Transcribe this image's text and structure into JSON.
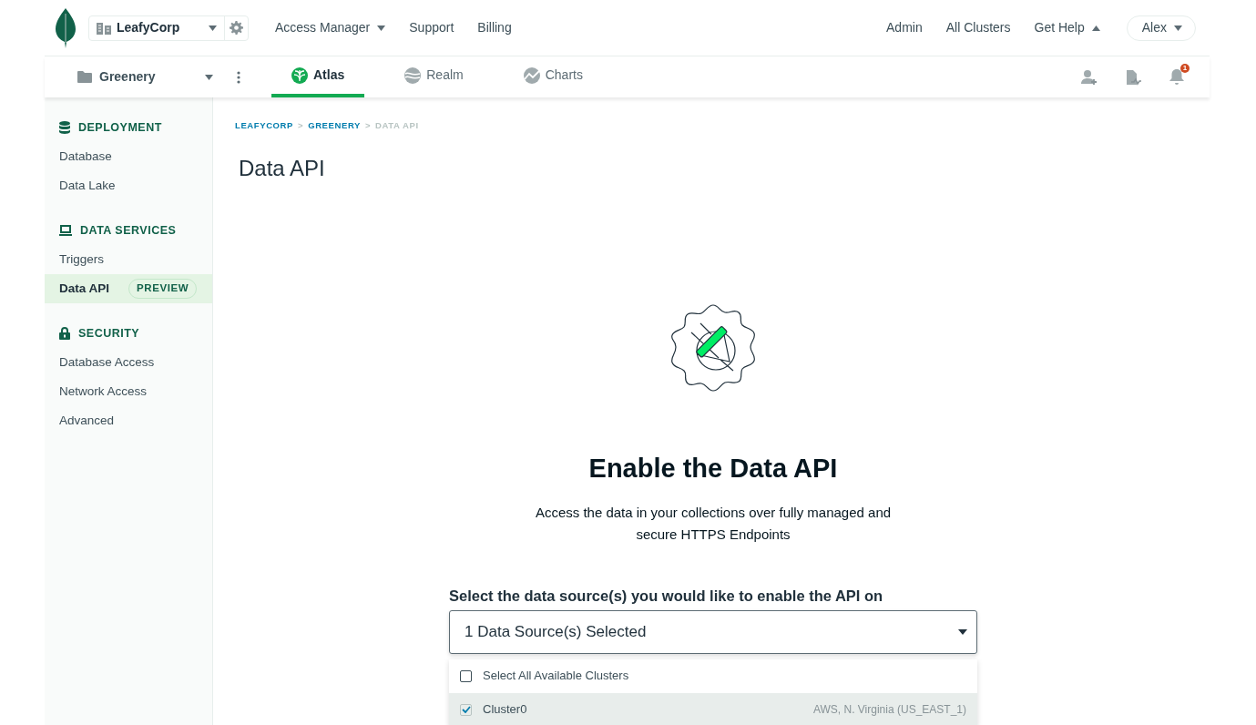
{
  "top_nav": {
    "org": "LeafyCorp",
    "links": [
      {
        "label": "Access Manager",
        "dropdown": true,
        "expanded": false
      },
      {
        "label": "Support",
        "dropdown": false
      },
      {
        "label": "Billing",
        "dropdown": false
      }
    ],
    "right_links": [
      {
        "label": "Admin",
        "dropdown": false
      },
      {
        "label": "All Clusters",
        "dropdown": false
      },
      {
        "label": "Get Help",
        "dropdown": true,
        "expanded": true
      }
    ],
    "user": "Alex"
  },
  "project_nav": {
    "project": "Greenery",
    "tabs": [
      {
        "label": "Atlas",
        "selected": true
      },
      {
        "label": "Realm",
        "selected": false
      },
      {
        "label": "Charts",
        "selected": false
      }
    ],
    "notification_count": "1"
  },
  "sidebar": {
    "sections": [
      {
        "title": "DEPLOYMENT",
        "items": [
          {
            "label": "Database",
            "selected": false
          },
          {
            "label": "Data Lake",
            "selected": false
          }
        ]
      },
      {
        "title": "DATA SERVICES",
        "items": [
          {
            "label": "Triggers",
            "selected": false
          },
          {
            "label": "Data API",
            "selected": true,
            "badge": "PREVIEW"
          }
        ]
      },
      {
        "title": "SECURITY",
        "items": [
          {
            "label": "Database Access",
            "selected": false
          },
          {
            "label": "Network Access",
            "selected": false
          },
          {
            "label": "Advanced",
            "selected": false
          }
        ]
      }
    ]
  },
  "breadcrumb": [
    {
      "kind": "link",
      "label": "LEAFYCORP"
    },
    {
      "kind": "separator",
      "label": ">"
    },
    {
      "kind": "link",
      "label": "GREENERY"
    },
    {
      "kind": "separator",
      "label": ">"
    },
    {
      "kind": "current",
      "label": "DATA API"
    }
  ],
  "page_title": "Data API",
  "hero": {
    "title": "Enable the Data API",
    "description": "Access the data in your collections over fully managed and secure HTTPS Endpoints"
  },
  "data_source": {
    "label": "Select the data source(s) you would like to enable the API on",
    "value": "1 Data Source(s) Selected",
    "options": [
      {
        "kind": "select_all",
        "label": "Select All Available Clusters",
        "checked": false
      },
      {
        "kind": "cluster",
        "label": "Cluster0",
        "region": "AWS, N. Virginia (US_EAST_1)",
        "checked": true
      }
    ]
  }
}
